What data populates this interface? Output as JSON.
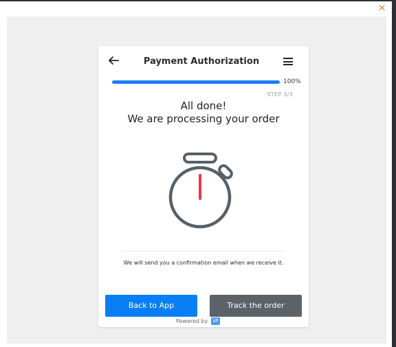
{
  "header": {
    "title": "Payment Authorization"
  },
  "progress": {
    "percent_label": "100%",
    "fraction": 1.0,
    "step_label": "STEP 3/3"
  },
  "message": {
    "line1": "All done!",
    "line2": "We are processing your order",
    "email_note": "We will send you a confirmation email when we receive it."
  },
  "buttons": {
    "back_label": "Back to App",
    "track_label": "Track the order"
  },
  "footer": {
    "powered_by": "Powered by",
    "logo_text": "sP"
  },
  "close_label": "×",
  "colors": {
    "primary": "#0a7ff5",
    "secondary_button": "#5b6368",
    "stopwatch_outline": "#556068",
    "stopwatch_hand": "#e8384b",
    "close": "#e48a1a"
  },
  "icons": {
    "back": "arrow-left-icon",
    "menu": "hamburger-menu-icon",
    "illustration": "stopwatch-icon",
    "close": "close-icon"
  }
}
